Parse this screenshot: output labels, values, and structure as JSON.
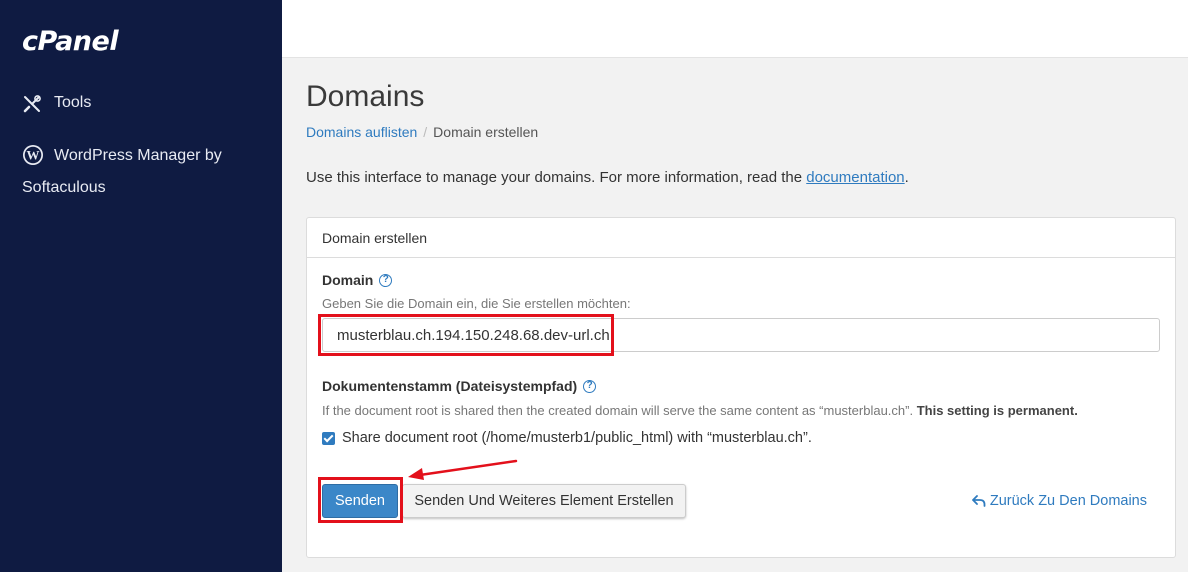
{
  "sidebar": {
    "logo": "cPanel",
    "items": [
      {
        "label": "Tools",
        "icon": "tools-icon"
      },
      {
        "label_line1": "WordPress Manager by",
        "label_line2": "Softaculous",
        "icon": "wordpress-icon"
      }
    ]
  },
  "header": {
    "title": "Domains"
  },
  "breadcrumb": {
    "link": "Domains auflisten",
    "separator": "/",
    "current": "Domain erstellen"
  },
  "intro": {
    "text": "Use this interface to manage your domains. For more information, read the",
    "link": "documentation",
    "after": "."
  },
  "panel": {
    "title": "Domain erstellen",
    "domain_label": "Domain",
    "domain_help": "Geben Sie die Domain ein, die Sie erstellen möchten:",
    "domain_value": "musterblau.ch.194.150.248.68.dev-url.ch",
    "docroot_label": "Dokumentenstamm (Dateisystempfad)",
    "docroot_help": "If the document root is shared then the created domain will serve the same content as “musterblau.ch”.",
    "docroot_help_bold": "This setting is permanent.",
    "share_checkbox_label": "Share document root (/home/musterb1/public_html) with “musterblau.ch”.",
    "share_checked": true,
    "submit_label": "Senden",
    "submit_more_label": "Senden Und Weiteres Element Erstellen",
    "back_label": "Zurück Zu Den Domains"
  },
  "colors": {
    "sidebar_bg": "#0f1b42",
    "link": "#2f7bbf",
    "primary": "#3b87c8",
    "highlight": "#e3101b"
  }
}
